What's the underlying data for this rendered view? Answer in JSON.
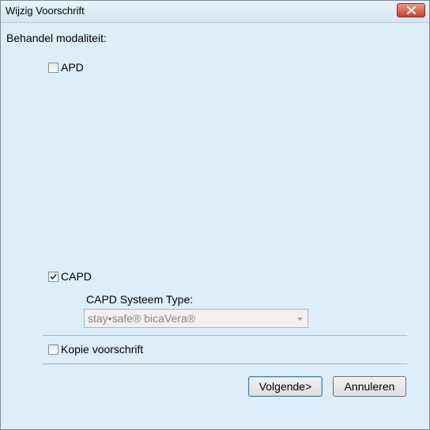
{
  "window": {
    "title": "Wijzig Voorschrift"
  },
  "form": {
    "modality_label": "Behandel modaliteit:",
    "apd": {
      "label": "APD",
      "checked": false
    },
    "capd": {
      "label": "CAPD",
      "checked": true
    },
    "capd_system_type": {
      "label": "CAPD Systeem Type:",
      "selected": "stay•safe® bicaVera®",
      "enabled": false
    },
    "copy_prescription": {
      "label": "Kopie voorschrift",
      "checked": false
    }
  },
  "buttons": {
    "next": "Volgende>",
    "cancel": "Annuleren"
  },
  "colors": {
    "background": "#dbeefa",
    "close_button": "#c6442e",
    "default_button_border": "#3c7fb1"
  }
}
